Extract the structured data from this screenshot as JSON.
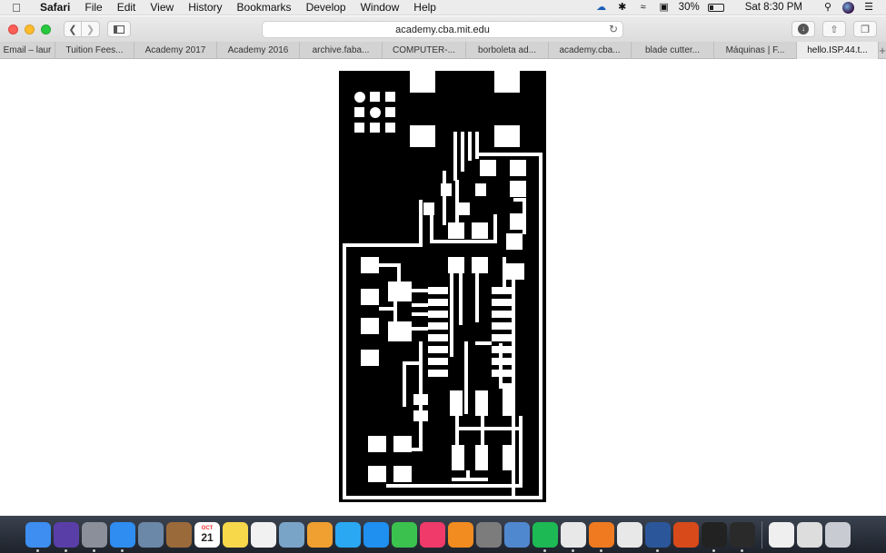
{
  "menubar": {
    "apple_icon": "apple-icon",
    "app_name": "Safari",
    "items": [
      "File",
      "Edit",
      "View",
      "History",
      "Bookmarks",
      "Develop",
      "Window",
      "Help"
    ],
    "battery_percent": "30%",
    "clock": "Sat 8:30 PM"
  },
  "toolbar": {
    "url": "academy.cba.mit.edu"
  },
  "tabs": [
    {
      "label": "Email – laur"
    },
    {
      "label": "Tuition Fees..."
    },
    {
      "label": "Academy 2017"
    },
    {
      "label": "Academy 2016"
    },
    {
      "label": "archive.faba..."
    },
    {
      "label": "COMPUTER-..."
    },
    {
      "label": "borboleta ad..."
    },
    {
      "label": "academy.cba..."
    },
    {
      "label": "blade cutter..."
    },
    {
      "label": "Máquinas | F..."
    },
    {
      "label": "hello.ISP.44.t..."
    }
  ],
  "content": {
    "image_icon": "pcb-traces-image",
    "colors": {
      "board": "#000000",
      "trace": "#ffffff"
    }
  },
  "dock": {
    "calendar_day": "21",
    "calendar_month": "OCT",
    "items": [
      {
        "name": "finder",
        "color": "#3d8ef0"
      },
      {
        "name": "siri",
        "color": "#5a3ea8"
      },
      {
        "name": "launchpad",
        "color": "#8a8f99"
      },
      {
        "name": "safari",
        "color": "#2f8cf0"
      },
      {
        "name": "preview",
        "color": "#6c88a8"
      },
      {
        "name": "notebook",
        "color": "#9b6a3a"
      },
      {
        "name": "calendar",
        "color": "#ffffff"
      },
      {
        "name": "notes",
        "color": "#f7d84b"
      },
      {
        "name": "reminders",
        "color": "#f1f1f1"
      },
      {
        "name": "image-capture",
        "color": "#7aa3c8"
      },
      {
        "name": "photos",
        "color": "#f0a030"
      },
      {
        "name": "messages",
        "color": "#2aa8f2"
      },
      {
        "name": "app-store",
        "color": "#1f8ff0"
      },
      {
        "name": "facetime",
        "color": "#3bc24e"
      },
      {
        "name": "itunes",
        "color": "#ef3a6a"
      },
      {
        "name": "ibooks",
        "color": "#f28b20"
      },
      {
        "name": "system-preferences",
        "color": "#7c7c7c"
      },
      {
        "name": "globe",
        "color": "#5088d0"
      },
      {
        "name": "spotify",
        "color": "#1db954"
      },
      {
        "name": "chrome",
        "color": "#e8e8e8"
      },
      {
        "name": "fusion-360",
        "color": "#f07a20"
      },
      {
        "name": "textedit",
        "color": "#e8e8e8"
      },
      {
        "name": "word",
        "color": "#2b579a"
      },
      {
        "name": "fire-app",
        "color": "#d84a1a"
      },
      {
        "name": "inkscape",
        "color": "#222222"
      },
      {
        "name": "x11",
        "color": "#2a2a2a"
      },
      {
        "name": "document",
        "color": "#efefef"
      },
      {
        "name": "window",
        "color": "#dddddd"
      },
      {
        "name": "trash",
        "color": "#c8ccd2"
      }
    ]
  }
}
